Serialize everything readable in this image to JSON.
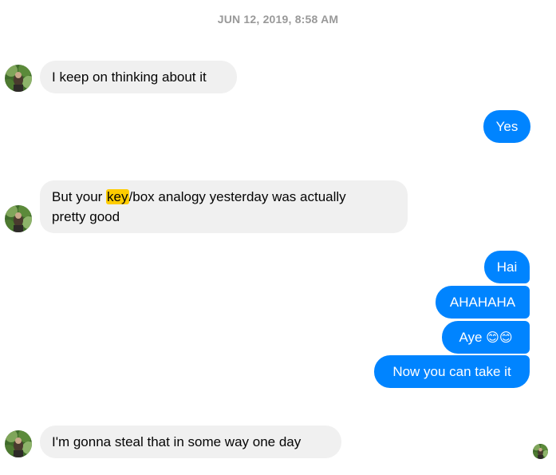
{
  "timestamp": "JUN 12, 2019, 8:58 AM",
  "messages": [
    {
      "text": "I keep on thinking about it"
    },
    {
      "text": "Yes"
    },
    {
      "before": "But your ",
      "highlight": "key",
      "after": "/box analogy yesterday was actually",
      "line2": "pretty good"
    },
    {
      "text": "Hai"
    },
    {
      "text": "AHAHAHA"
    },
    {
      "text": "Aye ",
      "emoji": "😊😊"
    },
    {
      "text": "Now you can take it"
    },
    {
      "text": "I'm gonna steal that in some way one day"
    }
  ],
  "colors": {
    "outgoing": "#0084ff",
    "incoming": "#f0f0f0",
    "highlight": "#ffcc00",
    "timestamp": "#999999"
  },
  "icons": {
    "avatar": "contact-avatar-photo",
    "seen": "seen-avatar-photo"
  }
}
